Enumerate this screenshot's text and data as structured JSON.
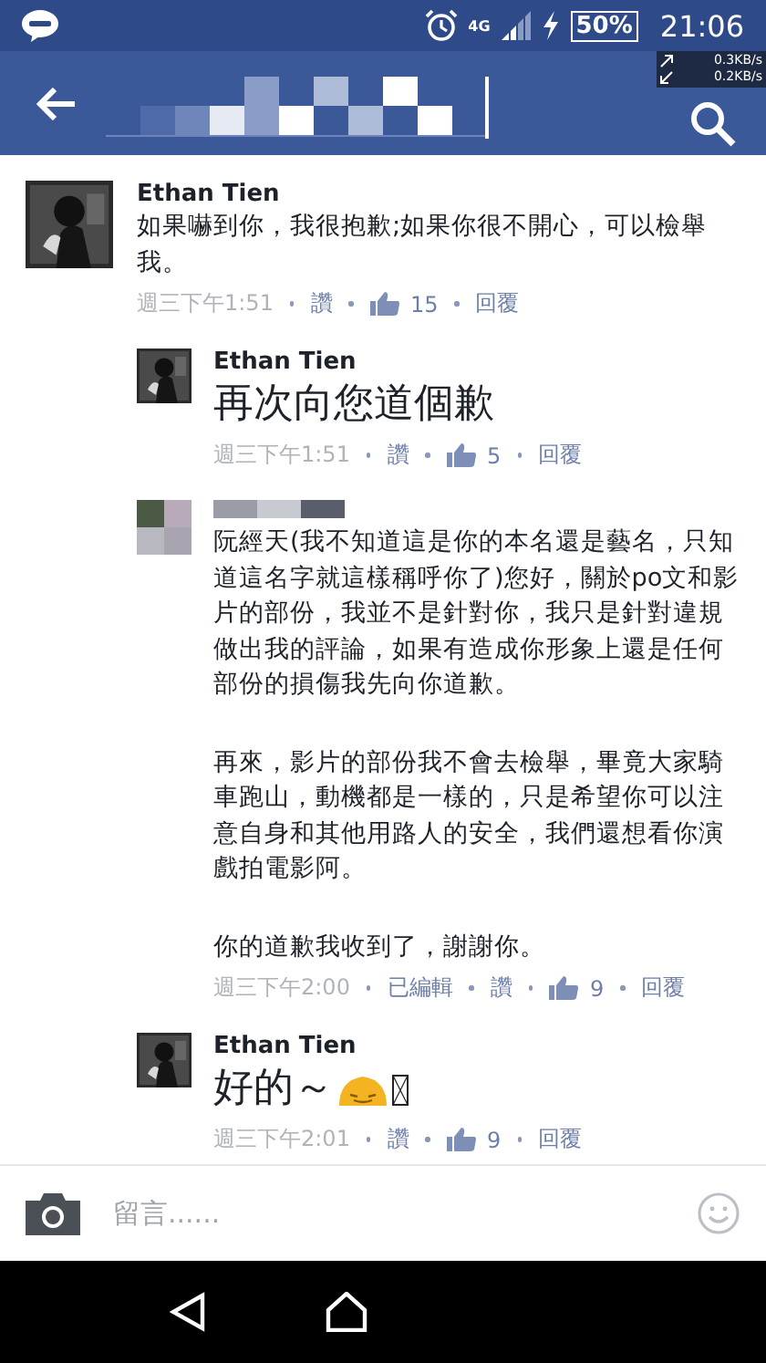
{
  "status_bar": {
    "battery": "50%",
    "time": "21:06",
    "network": "4G",
    "upload": "0.3KB/s",
    "download": "0.2KB/s"
  },
  "comments": [
    {
      "name": "Ethan Tien",
      "name_redacted": false,
      "large": false,
      "text": "如果嚇到你，我很抱歉;如果你很不開心，可以檢舉我。",
      "time": "週三下午1:51",
      "like": "讚",
      "likes": "15",
      "reply": "回覆",
      "emoji": false,
      "children": [
        {
          "name": "Ethan Tien",
          "name_redacted": false,
          "large": true,
          "text": "再次向您道個歉",
          "time": "週三下午1:51",
          "like": "讚",
          "likes": "5",
          "reply": "回覆",
          "emoji": false
        },
        {
          "name_redacted": true,
          "large": false,
          "paragraphs": [
            "阮經天(我不知道這是你的本名還是藝名，只知道這名字就這樣稱呼你了)您好，關於po文和影片的部份，我並不是針對你，我只是針對違規做出我的評論，如果有造成你形象上還是任何部份的損傷我先向你道歉。",
            "再來，影片的部份我不會去檢舉，畢竟大家騎車跑山，動機都是一樣的，只是希望你可以注意自身和其他用路人的安全，我們還想看你演戲拍電影阿。",
            "你的道歉我收到了，謝謝你。"
          ],
          "time": "週三下午2:00",
          "edited": "已編輯",
          "like": "讚",
          "likes": "9",
          "reply": "回覆"
        },
        {
          "name": "Ethan Tien",
          "name_redacted": false,
          "large": true,
          "text": "好的～",
          "time": "週三下午2:01",
          "like": "讚",
          "likes": "9",
          "reply": "回覆",
          "emoji": true
        }
      ]
    }
  ],
  "composer": {
    "placeholder": "留言......"
  }
}
